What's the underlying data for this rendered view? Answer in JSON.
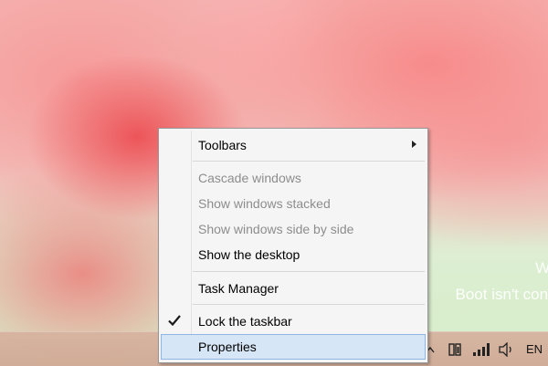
{
  "desktop": {
    "watermark_line1": "Wi",
    "watermark_line2": "Boot isn't config"
  },
  "context_menu": {
    "items": [
      {
        "label": "Toolbars",
        "enabled": true,
        "has_submenu": true
      },
      {
        "label": "Cascade windows",
        "enabled": false
      },
      {
        "label": "Show windows stacked",
        "enabled": false
      },
      {
        "label": "Show windows side by side",
        "enabled": false
      },
      {
        "label": "Show the desktop",
        "enabled": true
      },
      {
        "label": "Task Manager",
        "enabled": true
      },
      {
        "label": "Lock the taskbar",
        "enabled": true,
        "checked": true
      },
      {
        "label": "Properties",
        "enabled": true,
        "highlighted": true
      }
    ]
  },
  "taskbar": {
    "tray": {
      "icons": [
        "show-hidden-icons-arrow-icon",
        "action-center-flag-icon",
        "network-signal-icon",
        "volume-icon"
      ],
      "language": "EN"
    }
  },
  "colors": {
    "menu_background": "#f5f5f5",
    "menu_highlight": "#d7e6f6",
    "menu_highlight_border": "#8fb5e2",
    "disabled_text": "#8d8d8d",
    "taskbar": "#d3ae9a"
  }
}
